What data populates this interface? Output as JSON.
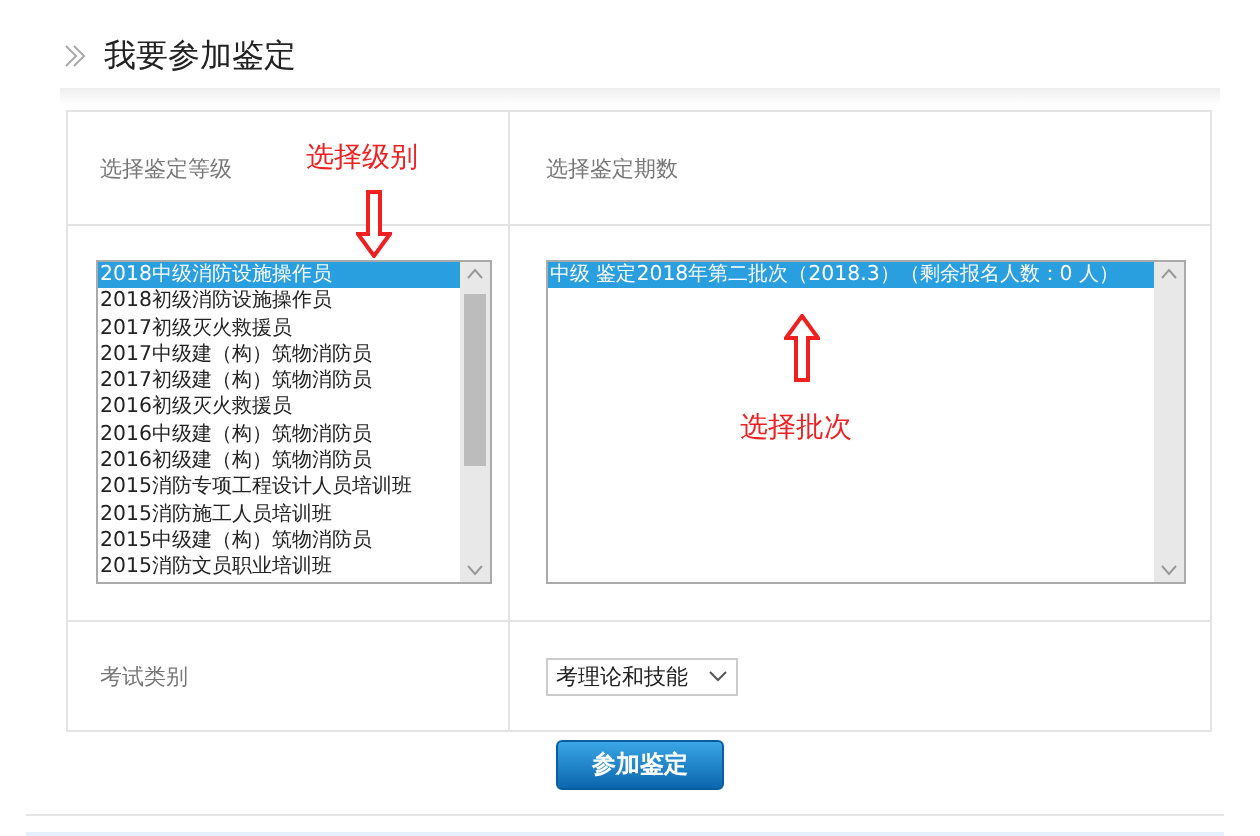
{
  "page_title": "我要参加鉴定",
  "form": {
    "level_label": "选择鉴定等级",
    "batch_label": "选择鉴定期数",
    "exam_type_label": "考试类别",
    "level_options": [
      {
        "label": "2018中级消防设施操作员",
        "selected": true
      },
      {
        "label": "2018初级消防设施操作员",
        "selected": false
      },
      {
        "label": "2017初级灭火救援员",
        "selected": false
      },
      {
        "label": "2017中级建（构）筑物消防员",
        "selected": false
      },
      {
        "label": "2017初级建（构）筑物消防员",
        "selected": false
      },
      {
        "label": "2016初级灭火救援员",
        "selected": false
      },
      {
        "label": "2016中级建（构）筑物消防员",
        "selected": false
      },
      {
        "label": "2016初级建（构）筑物消防员",
        "selected": false
      },
      {
        "label": "2015消防专项工程设计人员培训班",
        "selected": false
      },
      {
        "label": "2015消防施工人员培训班",
        "selected": false
      },
      {
        "label": "2015中级建（构）筑物消防员",
        "selected": false
      },
      {
        "label": "2015消防文员职业培训班",
        "selected": false
      }
    ],
    "batch_options": [
      {
        "label": "中级 鉴定2018年第二批次（2018.3）（剩余报名人数：0 人）",
        "selected": true
      }
    ],
    "exam_type_value": "考理论和技能"
  },
  "annotations": [
    {
      "text": "选择级别",
      "kind": "down"
    },
    {
      "text": "选择批次",
      "kind": "up"
    }
  ],
  "submit_button": "参加鉴定"
}
